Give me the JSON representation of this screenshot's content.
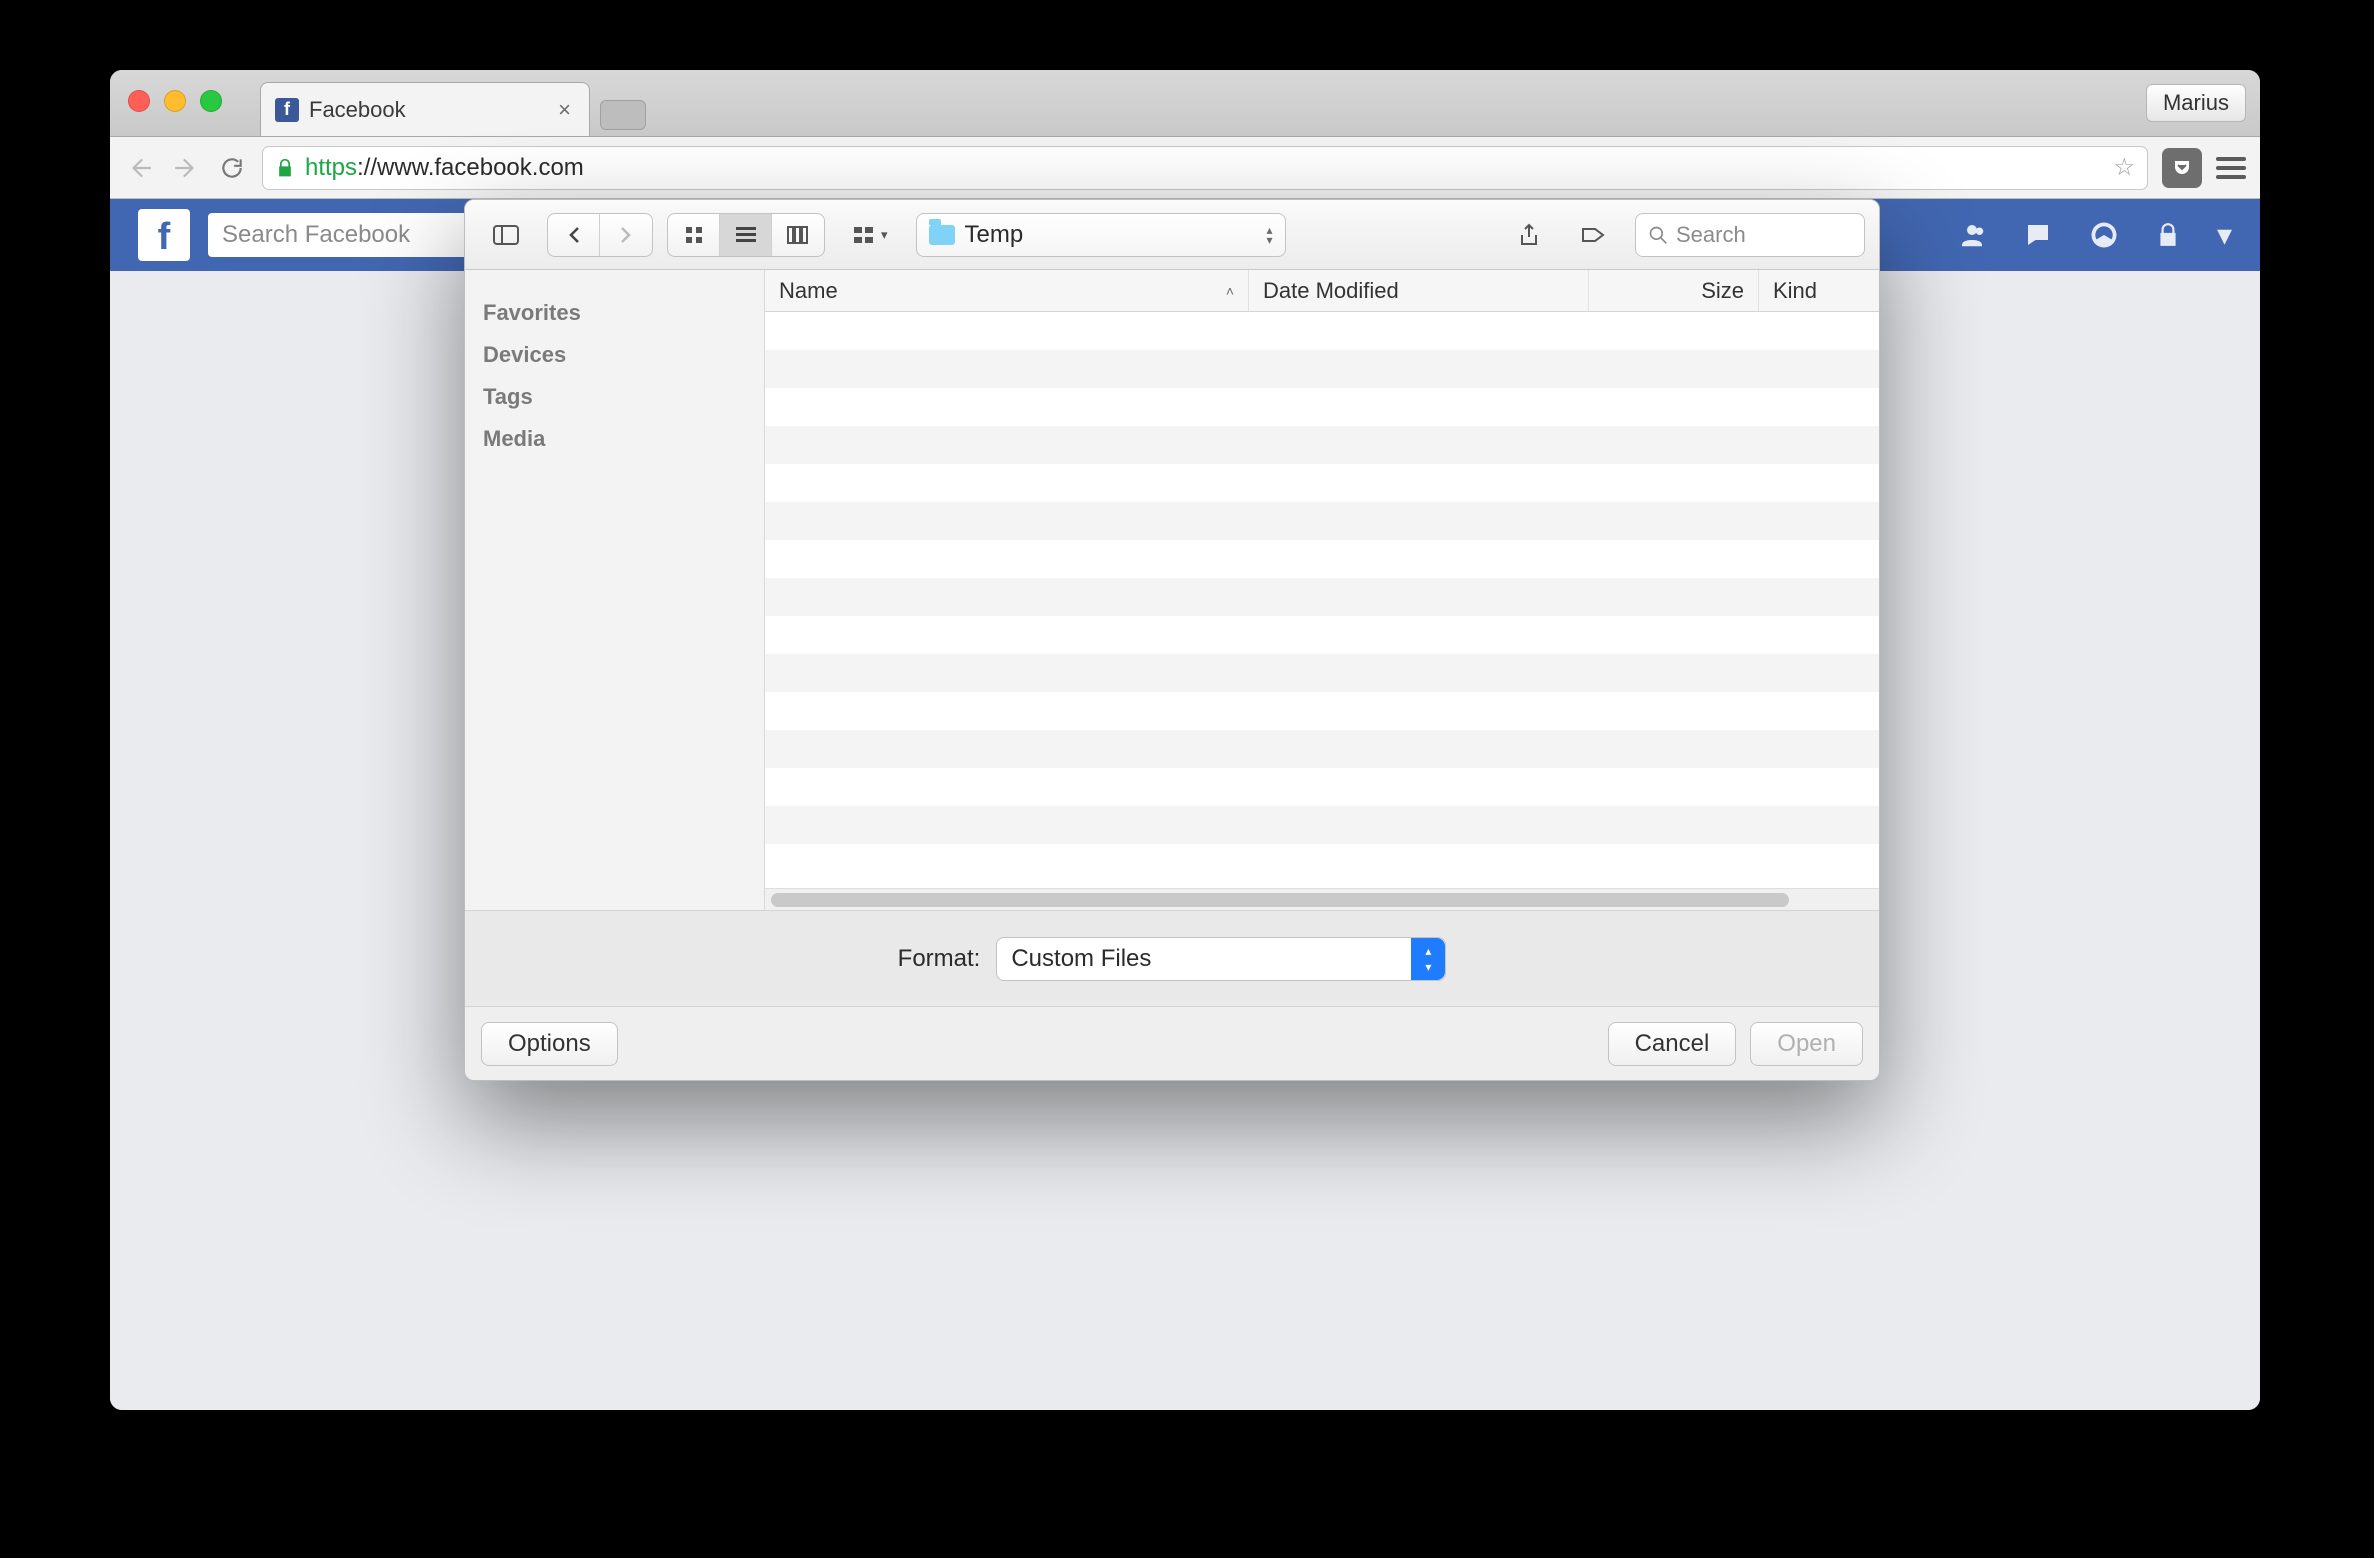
{
  "browser": {
    "tab_title": "Facebook",
    "profile_button": "Marius",
    "url_scheme": "https",
    "url_rest": "://www.facebook.com"
  },
  "facebook": {
    "search_placeholder": "Search Facebook"
  },
  "dialog": {
    "folder_name": "Temp",
    "search_placeholder": "Search",
    "sidebar": {
      "sections": [
        "Favorites",
        "Devices",
        "Tags",
        "Media"
      ]
    },
    "columns": {
      "name": "Name",
      "date": "Date Modified",
      "size": "Size",
      "kind": "Kind"
    },
    "format_label": "Format:",
    "format_value": "Custom Files",
    "buttons": {
      "options": "Options",
      "cancel": "Cancel",
      "open": "Open"
    }
  }
}
